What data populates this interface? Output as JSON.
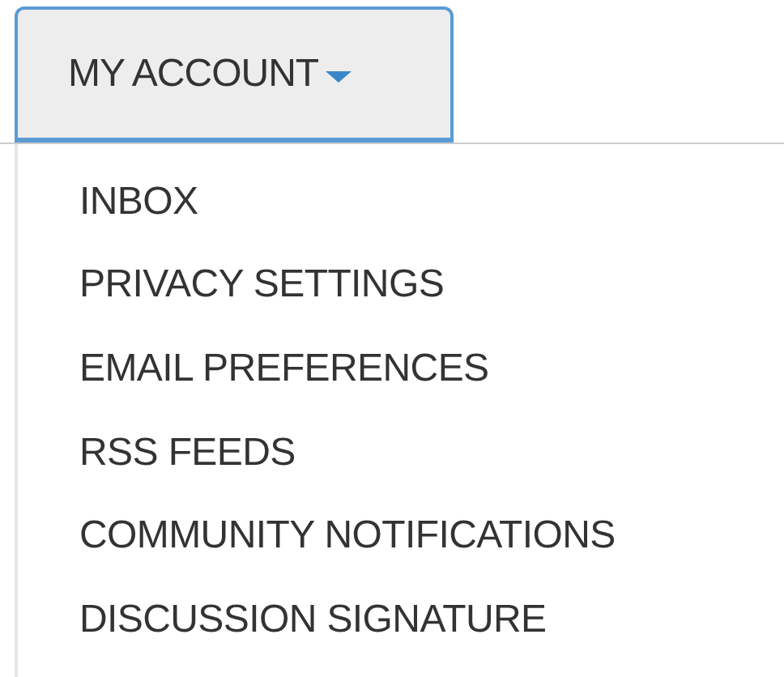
{
  "menu_button": {
    "label": "MY ACCOUNT",
    "expanded": true
  },
  "menu_items": [
    {
      "label": "INBOX"
    },
    {
      "label": "PRIVACY SETTINGS"
    },
    {
      "label": "EMAIL PREFERENCES"
    },
    {
      "label": "RSS FEEDS"
    },
    {
      "label": "COMMUNITY NOTIFICATIONS"
    },
    {
      "label": "DISCUSSION SIGNATURE"
    }
  ]
}
